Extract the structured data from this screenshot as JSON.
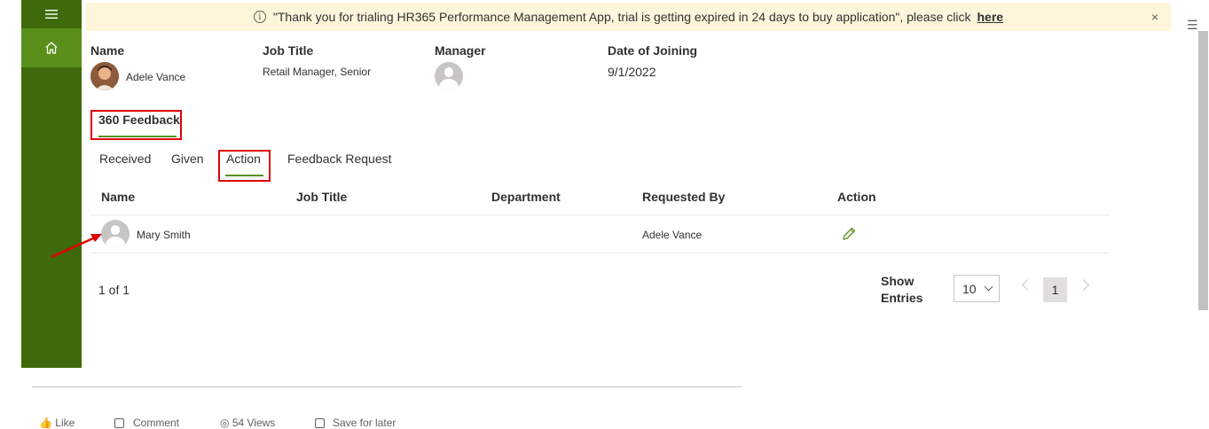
{
  "banner": {
    "message": "\"Thank you for trialing HR365 Performance Management App, trial is getting expired in 24 days to buy application\", please click",
    "link": "here",
    "close": "×"
  },
  "profile": {
    "name_header": "Name",
    "name": "Adele Vance",
    "job_title_header": "Job Title",
    "job_title": "Retail Manager, Senior",
    "manager_header": "Manager",
    "doj_header": "Date of Joining",
    "doj": "9/1/2022"
  },
  "section_title": "360 Feedback",
  "tabs": [
    {
      "label": "Received"
    },
    {
      "label": "Given"
    },
    {
      "label": "Action",
      "active": true
    },
    {
      "label": "Feedback Request"
    }
  ],
  "table": {
    "headers": [
      "Name",
      "Job Title",
      "Department",
      "Requested By",
      "Action"
    ],
    "rows": [
      {
        "name": "Mary Smith",
        "job_title": "",
        "department": "",
        "requested_by": "Adele Vance",
        "action_icon": "edit-pencil-icon"
      }
    ]
  },
  "pagination": {
    "summary": "1 of 1",
    "show_label_1": "Show",
    "show_label_2": "Entries",
    "entries_value": "10",
    "current_page": "1"
  },
  "colors": {
    "sidebar": "#3e6a0b",
    "sidebar_active": "#5a8f1a",
    "accent_green": "#5a8f1a",
    "banner_bg": "#fdf6db",
    "annotation_red": "#e00000"
  },
  "footer": {
    "like": "Like",
    "comment": "Comment",
    "views": "54 Views",
    "save": "Save for later"
  }
}
